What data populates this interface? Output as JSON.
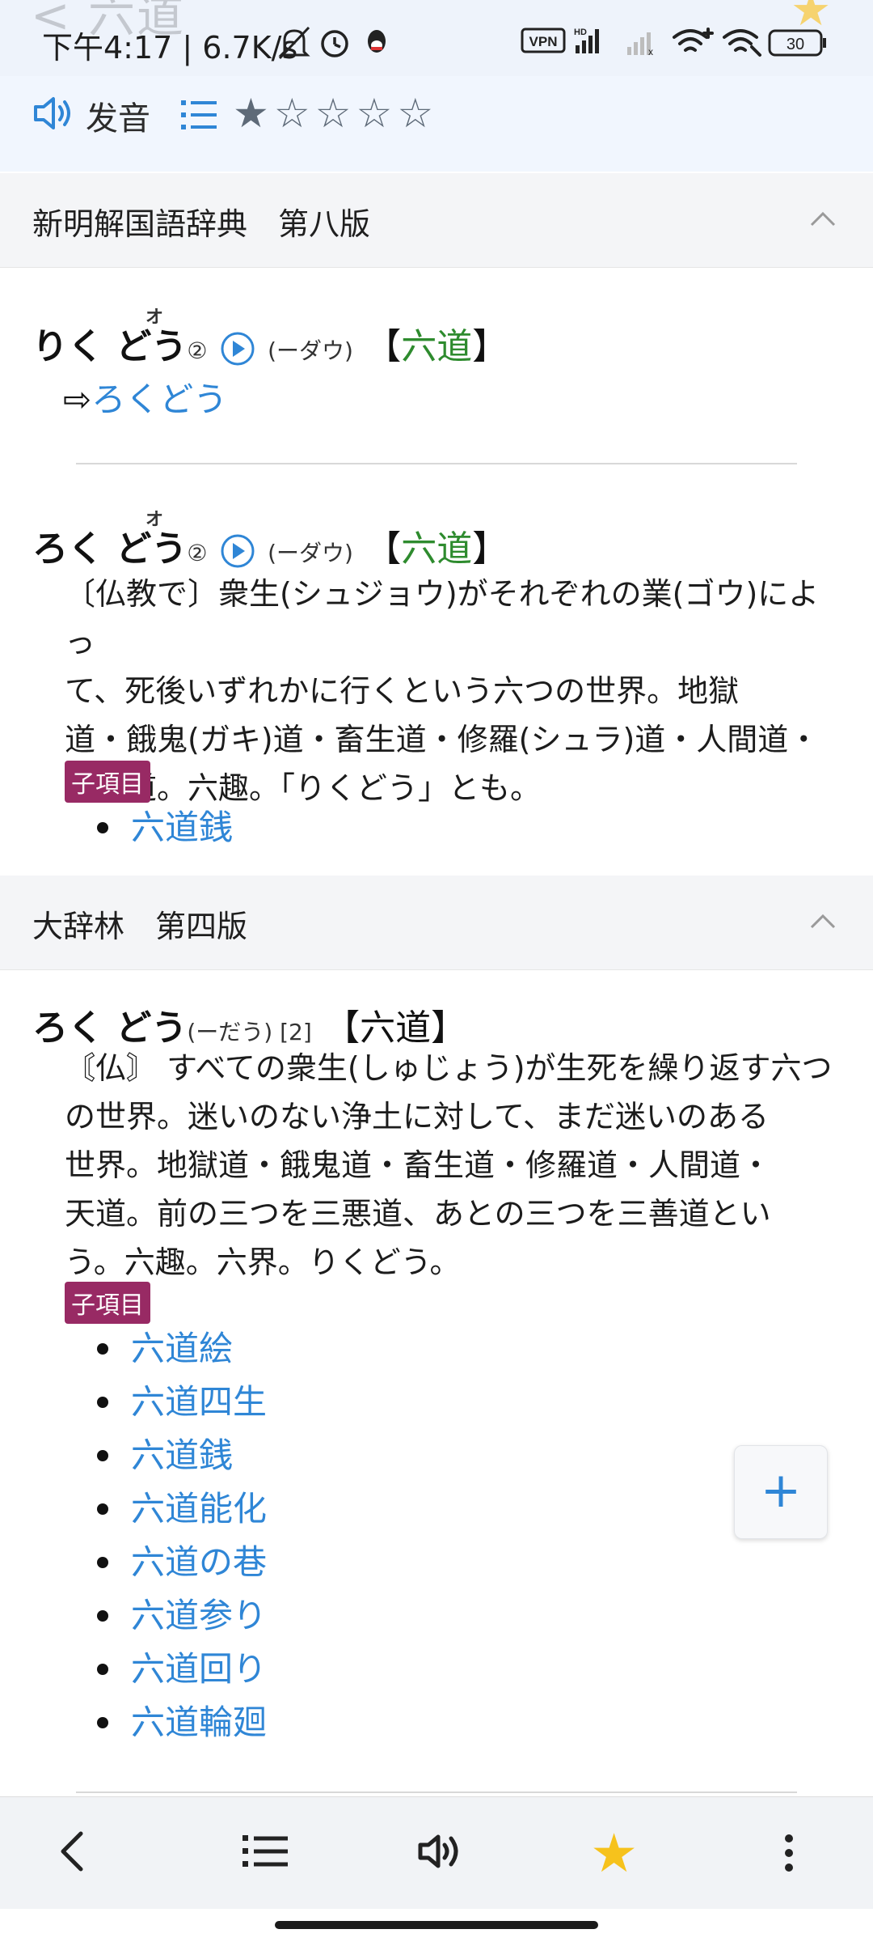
{
  "status_bar": {
    "behind_title": "< 六道",
    "time_speed": "下午4:17 | 6.7K/s",
    "icons": [
      "bell-off-icon",
      "alarm-icon",
      "qq-icon",
      "vpn-icon",
      "hd-signal-icon",
      "signal-off-icon",
      "wifi-plus-icon",
      "wifi-icon",
      "battery-icon"
    ],
    "vpn": "VPN",
    "battery": "30"
  },
  "toolbar": {
    "pronounce_label": "发音",
    "rating": 1,
    "max_rating": 5
  },
  "sections": [
    {
      "title": "新明解国語辞典　第八版",
      "entries": [
        {
          "kana": "りく どう",
          "ruby": "オ",
          "accent": "②",
          "reading_note": "(ーダウ)",
          "kanji": "六道",
          "see_also": "ろくどう"
        },
        {
          "kana": "ろく どう",
          "ruby": "オ",
          "accent": "②",
          "reading_note": "(ーダウ)",
          "kanji": "六道",
          "definition": "〔仏教で〕衆生⁽ˢʰᵘʲᵒᵘ⁾がそれぞれの業によって、死後いずれかに行くという六つの世界。地獄道・餓鬼道・畜生道・修羅道・人間道・天上道。六趣。「りくどう」とも。",
          "def_lines": [
            "〔仏教で〕衆生(シュジョウ)がそれぞれの業(ゴウ)によっ",
            "て、死後いずれかに行くという六つの世界。地獄",
            "道・餓鬼(ガキ)道・畜生道・修羅(シュラ)道・人間道・",
            "天上道。六趣。「りくどう」とも。"
          ],
          "sub_label": "子項目",
          "sub_items": [
            "六道銭"
          ]
        }
      ]
    },
    {
      "title": "大辞林　第四版",
      "entries": [
        {
          "kana": "ろく どう",
          "reading_note": "(ーだう) [2]",
          "kanji": "【六道】",
          "def_lines": [
            "〘仏〙 すべての衆生(しゅじょう)が生死を繰り返す六つ",
            "の世界。迷いのない浄土に対して、まだ迷いのある",
            "世界。地獄道・餓鬼道・畜生道・修羅道・人間道・",
            "天道。前の三つを三悪道、あとの三つを三善道とい",
            "う。六趣。六界。りくどう。"
          ],
          "sub_label": "子項目",
          "sub_items": [
            "六道絵",
            "六道四生",
            "六道銭",
            "六道能化",
            "六道の巷",
            "六道参り",
            "六道回り",
            "六道輪廻"
          ]
        }
      ]
    }
  ],
  "fab_symbol": "+",
  "bottom_nav": [
    "back-icon",
    "list-icon",
    "speaker-icon",
    "star-icon",
    "more-icon"
  ],
  "colors": {
    "accent_blue": "#2f86d6",
    "badge": "#982a64",
    "kanji_green": "#2e8b2e",
    "star_yellow": "#f6c21c"
  }
}
